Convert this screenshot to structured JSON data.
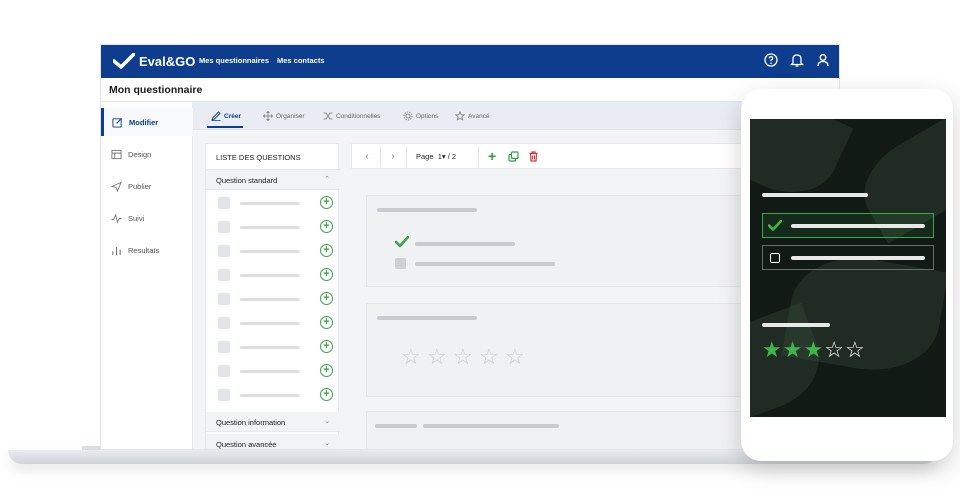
{
  "app": {
    "logo_text": "Eval&GO",
    "nav": [
      "Mes questionnaires",
      "Mes contacts"
    ],
    "icons": [
      "help-icon",
      "bell-icon",
      "user-icon"
    ],
    "brand_color": "#0d3d8c"
  },
  "page": {
    "title": "Mon questionnaire"
  },
  "sidebar": {
    "items": [
      {
        "label": "Modifier",
        "icon": "edit-icon",
        "active": true
      },
      {
        "label": "Design",
        "icon": "layout-icon"
      },
      {
        "label": "Publier",
        "icon": "send-icon"
      },
      {
        "label": "Suivi",
        "icon": "activity-icon"
      },
      {
        "label": "Resultats",
        "icon": "bar-chart-icon"
      }
    ]
  },
  "toolbar": {
    "tabs": [
      {
        "label": "Créer",
        "icon": "pencil-icon",
        "active": true
      },
      {
        "label": "Organiser",
        "icon": "move-icon"
      },
      {
        "label": "Conditionnelles",
        "icon": "shuffle-icon"
      },
      {
        "label": "Options",
        "icon": "gear-icon"
      },
      {
        "label": "Avancé",
        "icon": "star-icon"
      }
    ]
  },
  "question_list": {
    "header": "LISTE DES QUESTIONS",
    "sections": [
      {
        "label": "Question standard",
        "state": "expanded"
      },
      {
        "label": "Question information",
        "state": "collapsed"
      },
      {
        "label": "Question avancée",
        "state": "collapsed"
      }
    ]
  },
  "pager": {
    "page_label": "Page",
    "current": "1",
    "dropdown": "▾",
    "total": "/ 2"
  },
  "editor": {
    "rating_stars_count": 5
  },
  "phone": {
    "rating": {
      "filled": 3,
      "total": 5
    },
    "accent": "#3db64a"
  }
}
